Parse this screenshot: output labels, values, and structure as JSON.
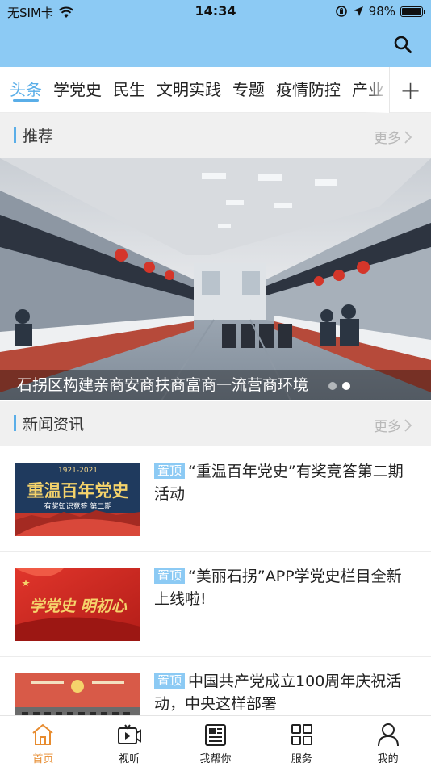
{
  "status_bar": {
    "carrier": "无SIM卡",
    "time": "14:34",
    "battery": "98%",
    "battery_level": 0.98
  },
  "header": {
    "background": "#8ccaf4",
    "search_icon": "search-icon"
  },
  "tabs": [
    {
      "label": "头条",
      "active": true
    },
    {
      "label": "学党史"
    },
    {
      "label": "民生"
    },
    {
      "label": "文明实践"
    },
    {
      "label": "专题"
    },
    {
      "label": "疫情防控"
    },
    {
      "label": "产业"
    }
  ],
  "tab_add_label": "+",
  "recommend": {
    "title": "推荐",
    "more": "更多",
    "banner_caption": "石拐区构建亲商安商扶商富商一流营商环境",
    "slide_count": 2,
    "active_slide": 1
  },
  "news": {
    "title": "新闻资讯",
    "more": "更多",
    "pin_label": "置顶",
    "items": [
      {
        "title": "“重温百年党史”有奖竞答第二期活动",
        "thumb": {
          "year": "1921-2021",
          "headline": "重温百年党史",
          "sub": "有奖知识竞答 第二期"
        }
      },
      {
        "title": "“美丽石拐”APP学党史栏目全新上线啦!",
        "thumb": {
          "headline": "学党史 明初心"
        }
      },
      {
        "title": "中国共产党成立100周年庆祝活动，中央这样部署",
        "thumb": {}
      }
    ]
  },
  "bottom_nav": [
    {
      "label": "首页",
      "icon": "home-icon",
      "active": true
    },
    {
      "label": "视听",
      "icon": "tv-icon"
    },
    {
      "label": "我帮你",
      "icon": "newspaper-icon"
    },
    {
      "label": "服务",
      "icon": "grid-icon"
    },
    {
      "label": "我的",
      "icon": "user-icon"
    }
  ],
  "colors": {
    "accent": "#5aaee8",
    "nav_active": "#e78b2e",
    "pin_bg": "#8ccaf4"
  }
}
